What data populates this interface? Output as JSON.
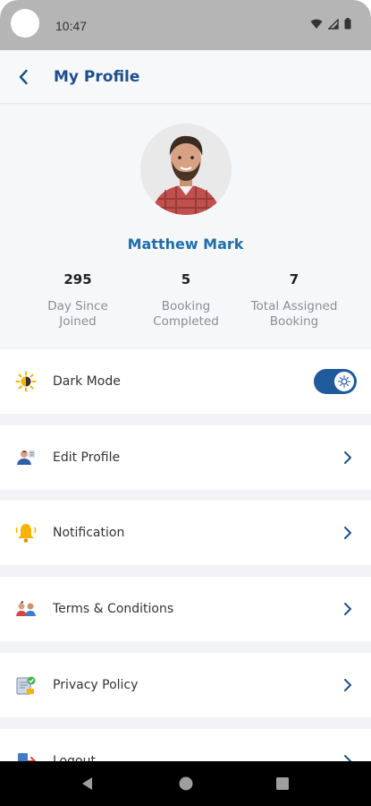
{
  "status_bar": {
    "time": "10:47"
  },
  "header": {
    "title": "My Profile"
  },
  "profile": {
    "name": "Matthew Mark",
    "stats": [
      {
        "value": "295",
        "label_line1": "Day Since",
        "label_line2": "Joined"
      },
      {
        "value": "5",
        "label_line1": "Booking",
        "label_line2": "Completed"
      },
      {
        "value": "7",
        "label_line1": "Total Assigned",
        "label_line2": "Booking"
      }
    ]
  },
  "settings": {
    "dark_mode": {
      "label": "Dark Mode",
      "enabled": true,
      "icon": "sun-icon"
    },
    "items": [
      {
        "label": "Edit Profile",
        "icon": "edit-profile-icon"
      },
      {
        "label": "Notification",
        "icon": "bell-icon"
      },
      {
        "label": "Terms & Conditions",
        "icon": "terms-icon"
      },
      {
        "label": "Privacy Policy",
        "icon": "privacy-icon"
      },
      {
        "label": "Logout",
        "icon": "logout-icon"
      }
    ]
  },
  "colors": {
    "accent": "#1d4f8c",
    "name": "#1f6eaa",
    "toggle": "#1f5a9b"
  }
}
